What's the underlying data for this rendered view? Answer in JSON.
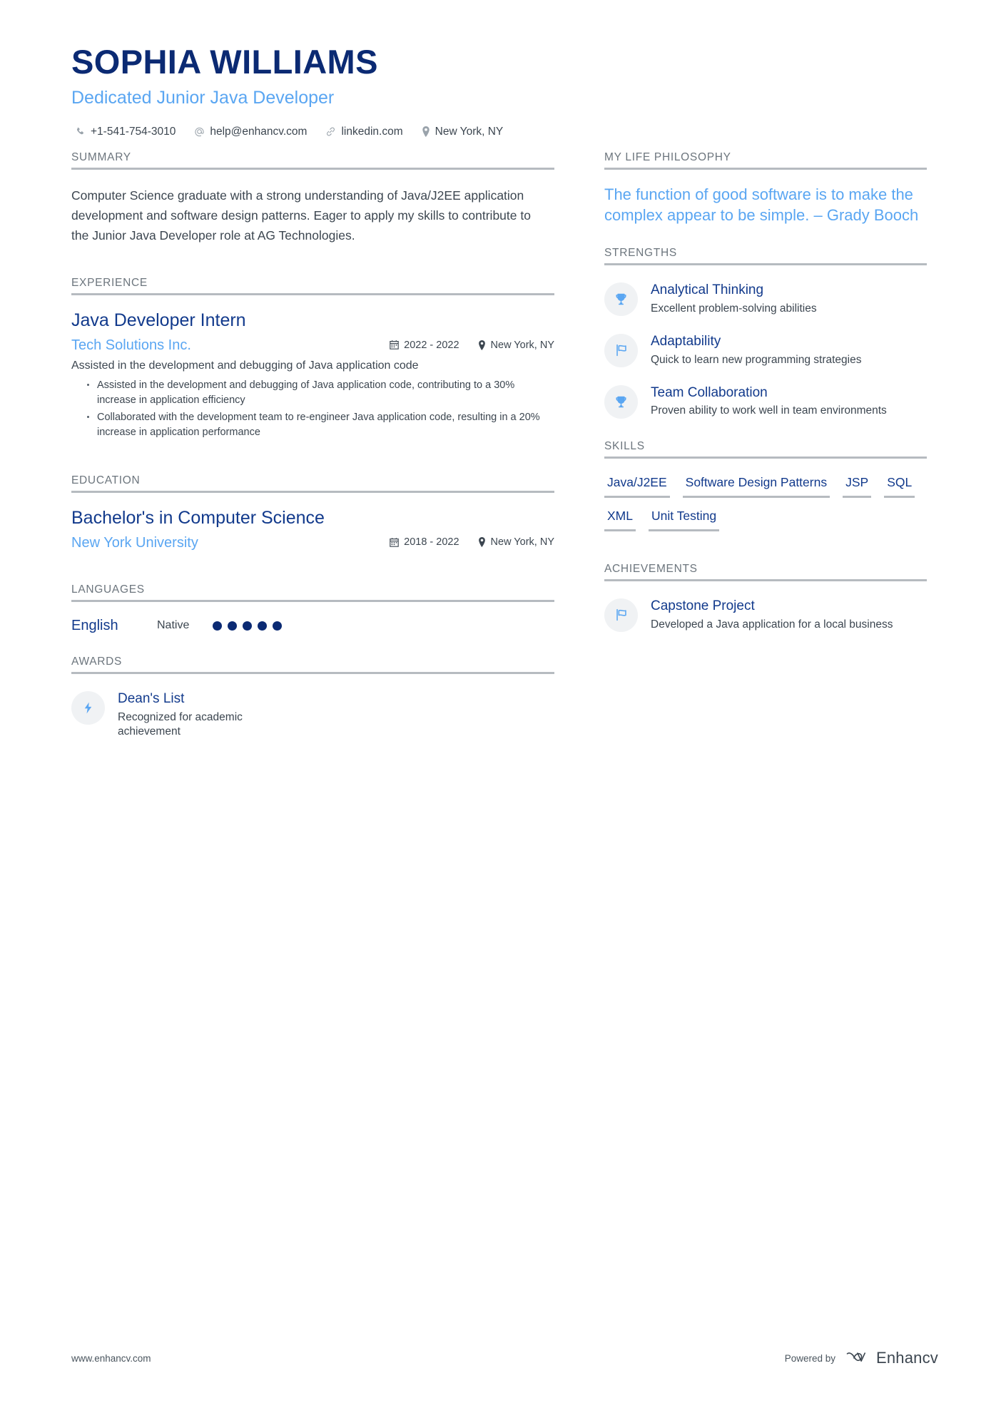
{
  "header": {
    "name": "SOPHIA WILLIAMS",
    "subtitle": "Dedicated Junior Java Developer",
    "contacts": [
      {
        "icon": "phone-icon",
        "text": "+1-541-754-3010"
      },
      {
        "icon": "at-email-icon",
        "text": "help@enhancv.com"
      },
      {
        "icon": "link-icon",
        "text": "linkedin.com"
      },
      {
        "icon": "location-pin-icon",
        "text": "New York, NY"
      }
    ]
  },
  "left": {
    "summary": {
      "title": "SUMMARY",
      "body": "Computer Science graduate with a strong understanding of Java/J2EE application development and software design patterns. Eager to apply my skills to contribute to the Junior Java Developer role at AG Technologies."
    },
    "experience": {
      "title": "EXPERIENCE",
      "entries": [
        {
          "role": "Java Developer Intern",
          "company": "Tech Solutions Inc.",
          "dates": "2022 - 2022",
          "location": "New York, NY",
          "description": "Assisted in the development and debugging of Java application code",
          "bullets": [
            "Assisted in the development and debugging of Java application code, contributing to a 30% increase in application efficiency",
            "Collaborated with the development team to re-engineer Java application code, resulting in a 20% increase in application performance"
          ]
        }
      ]
    },
    "education": {
      "title": "EDUCATION",
      "entries": [
        {
          "degree": "Bachelor's in Computer Science",
          "school": "New York University",
          "dates": "2018 - 2022",
          "location": "New York, NY"
        }
      ]
    },
    "languages": {
      "title": "LANGUAGES",
      "items": [
        {
          "name": "English",
          "level": "Native",
          "dots": 5,
          "dots_total": 5
        }
      ]
    },
    "awards": {
      "title": "AWARDS",
      "items": [
        {
          "icon": "lightning-bolt-icon",
          "title": "Dean's List",
          "subtitle": "Recognized for academic achievement"
        }
      ]
    }
  },
  "right": {
    "philosophy": {
      "title": "MY LIFE PHILOSOPHY",
      "quote": "The function of good software is to make the complex appear to be simple. – Grady Booch"
    },
    "strengths": {
      "title": "STRENGTHS",
      "items": [
        {
          "icon": "trophy-icon",
          "title": "Analytical Thinking",
          "subtitle": "Excellent problem-solving abilities"
        },
        {
          "icon": "flag-icon",
          "title": "Adaptability",
          "subtitle": "Quick to learn new programming strategies"
        },
        {
          "icon": "trophy-icon",
          "title": "Team Collaboration",
          "subtitle": "Proven ability to work well in team environments"
        }
      ]
    },
    "skills": {
      "title": "SKILLS",
      "items": [
        "Java/J2EE",
        "Software Design Patterns",
        "JSP",
        "SQL",
        "XML",
        "Unit Testing"
      ]
    },
    "achievements": {
      "title": "ACHIEVEMENTS",
      "items": [
        {
          "icon": "flag-icon",
          "title": "Capstone Project",
          "subtitle": "Developed a Java application for a local business"
        }
      ]
    }
  },
  "footer": {
    "website": "www.enhancv.com",
    "powered_by": "Powered by",
    "brand": "Enhancv"
  },
  "colors": {
    "navy": "#0b2a73",
    "title_blue": "#123a8c",
    "light_blue": "#5aa6f2",
    "rule_gray": "#b6bbc0",
    "body_gray": "#3c4650",
    "section_label": "#6c757d",
    "icon_circle_bg": "#f0f2f4"
  }
}
